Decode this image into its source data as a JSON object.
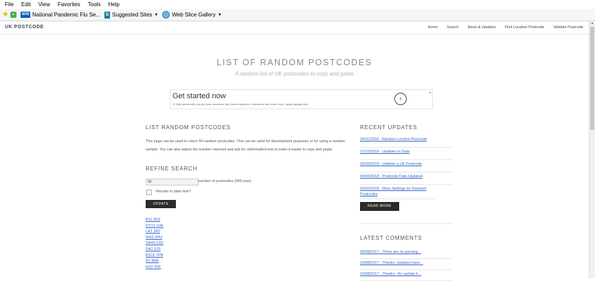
{
  "browser": {
    "menu": [
      "File",
      "Edit",
      "View",
      "Favorites",
      "Tools",
      "Help"
    ],
    "favorites": [
      {
        "label": "National Pandemic Flu Se...",
        "icon": "nhs-icon"
      },
      {
        "label": "Suggested Sites",
        "icon": "bing-icon"
      },
      {
        "label": "Web Slice Gallery",
        "icon": "ie-icon"
      }
    ],
    "nhs_badge": "NHS",
    "bing_badge": "b"
  },
  "site": {
    "brand": "UK POSTCODE",
    "nav": [
      "Home",
      "Search",
      "News & Updates",
      "Find Location Postcode",
      "Validate Postcode"
    ]
  },
  "hero": {
    "title": "LIST OF RANDOM POSTCODES",
    "subtitle": "A random list of UK postcodes to copy and paste"
  },
  "ad": {
    "headline": "Get started now",
    "body": "G Suite grows with you and your business. Add new employees, extensions and much more. gsuite.google.com",
    "arrow": "›"
  },
  "main": {
    "heading": "LIST RANDOM POSTCODES",
    "paragraph": "This page can be used to return 50 random postcodes. This can be used for development purposes or for using a random sample. You can also adjust the number returned and ask for unformatted text to make it easier to copy and paste.",
    "refine_heading": "REFINE SEARCH",
    "quantity_value": "50",
    "quantity_label": "number of postcodes (999 max)",
    "plain_text_label": "Results in plain text?",
    "update_button": "UPDATE",
    "postcodes": [
      "B11 3DZ",
      "DY13 1HE",
      "LA1 2AT",
      "WA3 2PH",
      "SA43 1SD",
      "DA1 6JS",
      "BS15 7PB",
      "N7 8HE",
      "EH2 4SF"
    ]
  },
  "sidebar": {
    "recent_heading": "RECENT UPDATES",
    "updates": [
      "24/11/2018 - Random London Postcode",
      "17/10/2018 - Updates to Data",
      "05/09/2018 - Validate a UK Postcode",
      "04/04/2018 - Postcode Data Updated",
      "03/02/2018 - More Settings for Random Postcodes"
    ],
    "read_more": "READ MORE",
    "comments_heading": "LATEST COMMENTS",
    "comments": [
      "09/08/2017 - There are no passing...",
      "19/08/2017 - Thanks. Updates have...",
      "19/08/2017 - Thanks - An update h..."
    ]
  }
}
